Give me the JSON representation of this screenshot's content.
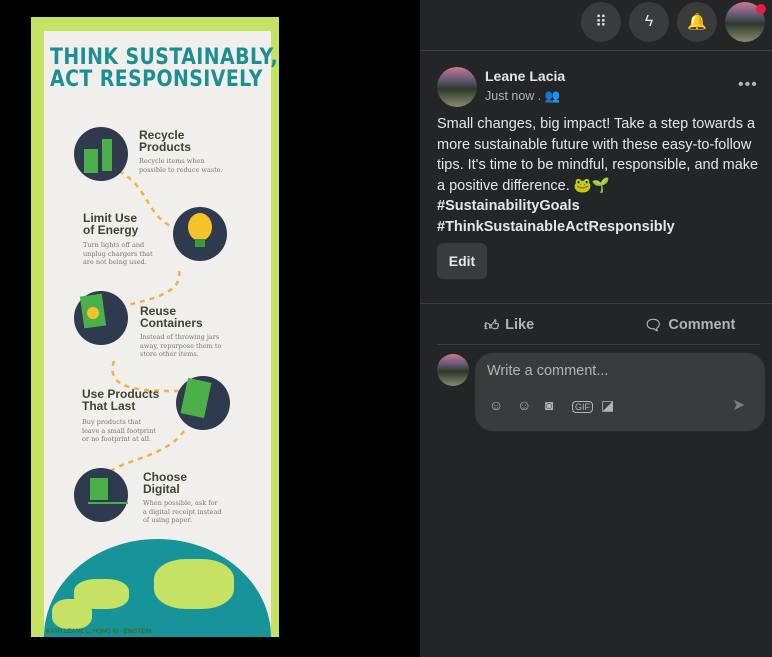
{
  "poster": {
    "title_line1": "THINK SUSTAINABLY,",
    "title_line2": "ACT RESPONSIVELY",
    "steps": [
      {
        "title": "Recycle\nProducts",
        "desc": "Recycle items when\npossible to reduce waste."
      },
      {
        "title": "Limit Use\nof Energy",
        "desc": "Turn lights off and\nunplug chargers that\nare not being used."
      },
      {
        "title": "Reuse\nContainers",
        "desc": "Instead of throwing jars\naway, repurpose them to\nstore other items."
      },
      {
        "title": "Use Products\nThat Last",
        "desc": "Buy products that\nleave a small footprint\nor no footprint at all."
      },
      {
        "title": "Choose\nDigital",
        "desc": "When possible, ask for\na digital receipt instead\nof using paper."
      }
    ],
    "credit": "KATH LEANE L. HONG XI - EINSTEIN",
    "colors": {
      "frame": "#c6e264",
      "title": "#1b8f93",
      "circle": "#2f3a4e",
      "earth": "#16949a"
    }
  },
  "topbar": {
    "icons": [
      "menu-grid-icon",
      "messenger-icon",
      "notifications-bell-icon",
      "profile-avatar"
    ]
  },
  "post": {
    "author": "Leane Lacia",
    "time": "Just now .",
    "audience_icon": "friends-icon",
    "text": "Small changes, big impact! Take a step towards a more sustainable future with these easy-to-follow tips. It's time to be mindful, responsible, and make a positive difference. 🐸🌱",
    "hashtags": [
      "#SustainabilityGoals",
      "#ThinkSustainableActResponsibly"
    ],
    "edit_label": "Edit",
    "more_label": "•••",
    "like_label": "Like",
    "comment_label": "Comment",
    "comment_placeholder": "Write a comment...",
    "comment_tools": [
      "avatar-sticker-icon",
      "emoji-icon",
      "camera-icon",
      "gif-icon",
      "sticker-icon"
    ],
    "send_icon": "send-icon"
  }
}
